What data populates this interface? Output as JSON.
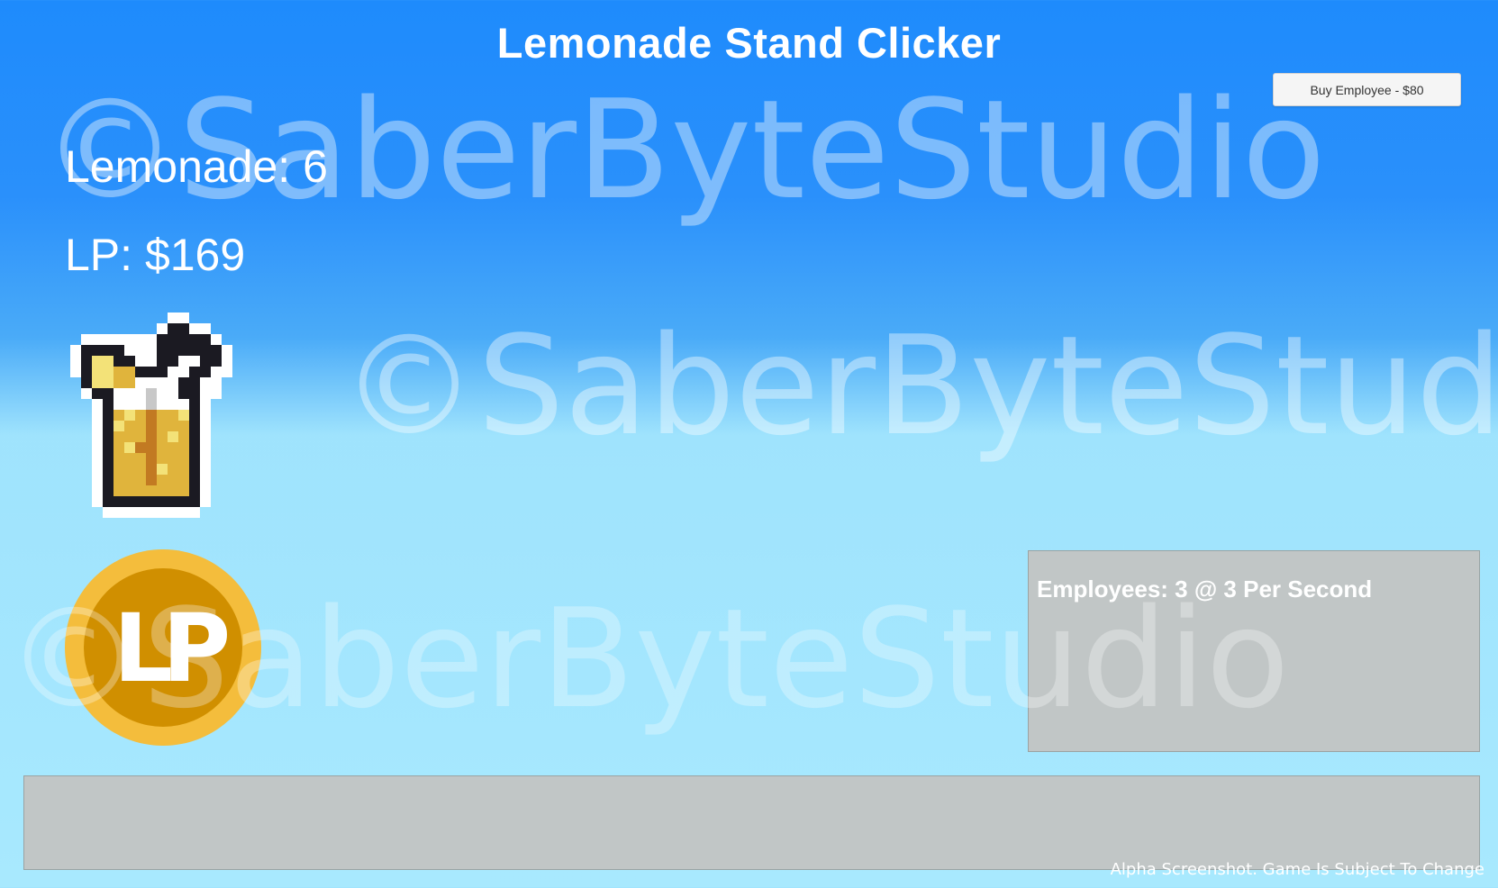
{
  "title": "Lemonade Stand Clicker",
  "buy_button": {
    "label": "Buy Employee - $80"
  },
  "stats": {
    "lemonade": "Lemonade: 6",
    "lp": "LP: $169"
  },
  "employees": {
    "status": "Employees: 3 @ 3 Per Second"
  },
  "watermark": {
    "text": "©SaberByteStudio"
  },
  "coin_logo_text": "LP",
  "footer": "Alpha Screenshot. Game Is Subject To Change",
  "icons": {
    "lemonade": "lemonade-glass-icon",
    "coin": "lp-coin-icon"
  },
  "colors": {
    "sky_top": "#1e8bfc",
    "sky_bottom": "#a8e9fe",
    "panel": "#c1c6c6",
    "lemonade": "#e0b43c",
    "coin_outer": "#f4bd3c",
    "coin_inner": "#d08f00"
  }
}
